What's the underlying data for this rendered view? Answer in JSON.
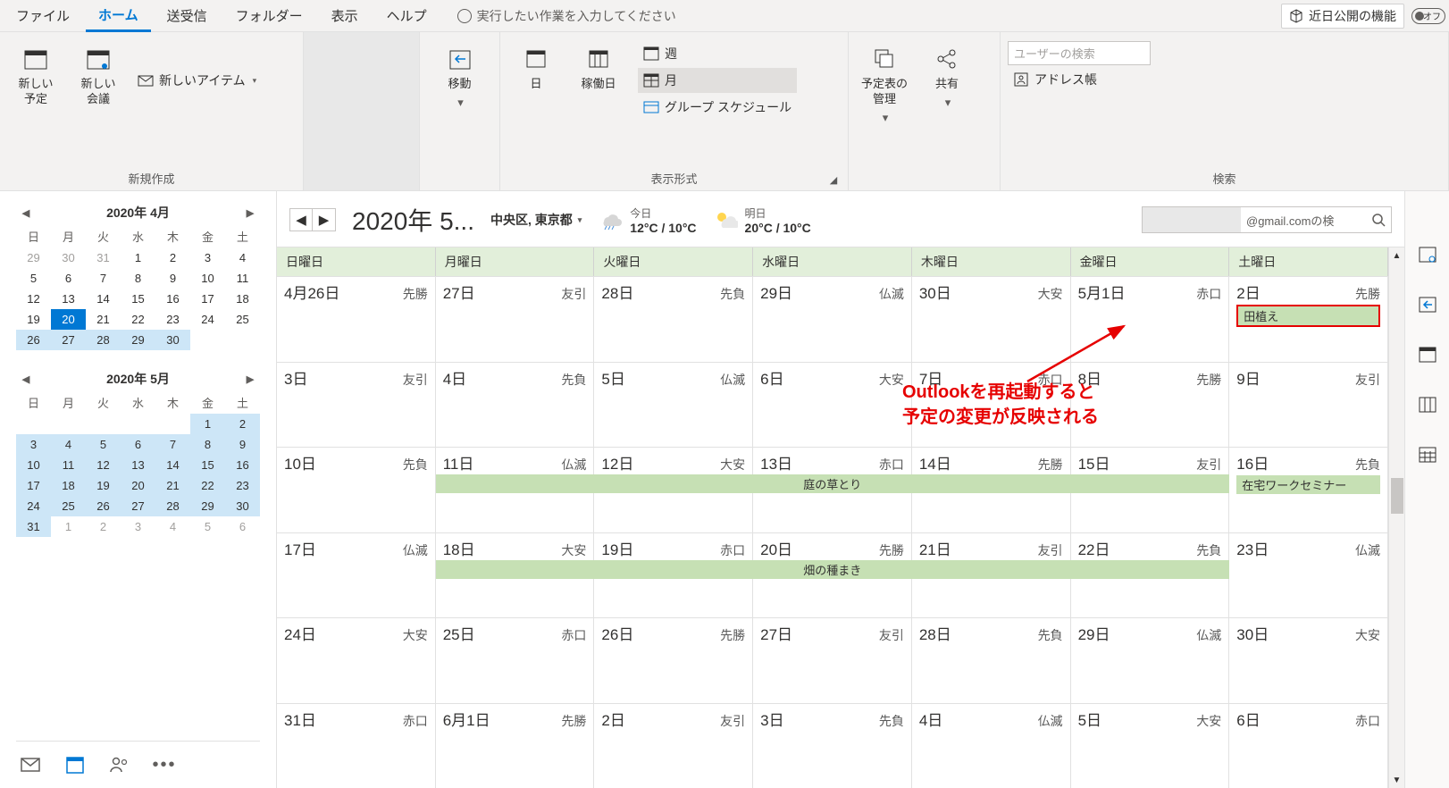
{
  "tabs": {
    "file": "ファイル",
    "home": "ホーム",
    "sendrecv": "送受信",
    "folder": "フォルダー",
    "view": "表示",
    "help": "ヘルプ",
    "tellme": "実行したい作業を入力してください",
    "coming": "近日公開の機能",
    "toggle_off": "オフ"
  },
  "ribbon": {
    "new": {
      "label": "新規作成",
      "appt": "新しい\n予定",
      "meeting": "新しい\n会議",
      "items": "新しいアイテム"
    },
    "goto": {
      "move": "移動"
    },
    "arrange": {
      "label": "表示形式",
      "day": "日",
      "workweek": "稼働日",
      "week": "週",
      "month": "月",
      "group": "グループ スケジュール"
    },
    "manage": {
      "schedule": "予定表の\n管理",
      "share": "共有"
    },
    "find": {
      "label": "検索",
      "search_user": "ユーザーの検索",
      "address": "アドレス帳"
    }
  },
  "mini": {
    "apr": {
      "title": "2020年 4月",
      "dow": [
        "日",
        "月",
        "火",
        "水",
        "木",
        "金",
        "土"
      ],
      "cells": [
        {
          "n": "29",
          "o": 1
        },
        {
          "n": "30",
          "o": 1
        },
        {
          "n": "31",
          "o": 1
        },
        {
          "n": "1"
        },
        {
          "n": "2"
        },
        {
          "n": "3"
        },
        {
          "n": "4"
        },
        {
          "n": "5"
        },
        {
          "n": "6"
        },
        {
          "n": "7"
        },
        {
          "n": "8"
        },
        {
          "n": "9"
        },
        {
          "n": "10"
        },
        {
          "n": "11"
        },
        {
          "n": "12"
        },
        {
          "n": "13"
        },
        {
          "n": "14"
        },
        {
          "n": "15"
        },
        {
          "n": "16"
        },
        {
          "n": "17"
        },
        {
          "n": "18"
        },
        {
          "n": "19"
        },
        {
          "n": "20",
          "t": 1
        },
        {
          "n": "21"
        },
        {
          "n": "22"
        },
        {
          "n": "23"
        },
        {
          "n": "24"
        },
        {
          "n": "25"
        },
        {
          "n": "26",
          "s": 1
        },
        {
          "n": "27",
          "s": 1
        },
        {
          "n": "28",
          "s": 1
        },
        {
          "n": "29",
          "s": 1
        },
        {
          "n": "30",
          "s": 1
        },
        {
          "n": ""
        },
        {
          "n": ""
        }
      ]
    },
    "may": {
      "title": "2020年 5月",
      "dow": [
        "日",
        "月",
        "火",
        "水",
        "木",
        "金",
        "土"
      ],
      "cells": [
        {
          "n": ""
        },
        {
          "n": ""
        },
        {
          "n": ""
        },
        {
          "n": ""
        },
        {
          "n": ""
        },
        {
          "n": "1",
          "s": 1
        },
        {
          "n": "2",
          "s": 1
        },
        {
          "n": "3",
          "s": 1
        },
        {
          "n": "4",
          "s": 1
        },
        {
          "n": "5",
          "s": 1
        },
        {
          "n": "6",
          "s": 1
        },
        {
          "n": "7",
          "s": 1
        },
        {
          "n": "8",
          "s": 1
        },
        {
          "n": "9",
          "s": 1
        },
        {
          "n": "10",
          "s": 1
        },
        {
          "n": "11",
          "s": 1
        },
        {
          "n": "12",
          "s": 1
        },
        {
          "n": "13",
          "s": 1
        },
        {
          "n": "14",
          "s": 1
        },
        {
          "n": "15",
          "s": 1
        },
        {
          "n": "16",
          "s": 1
        },
        {
          "n": "17",
          "s": 1
        },
        {
          "n": "18",
          "s": 1
        },
        {
          "n": "19",
          "s": 1
        },
        {
          "n": "20",
          "s": 1
        },
        {
          "n": "21",
          "s": 1
        },
        {
          "n": "22",
          "s": 1
        },
        {
          "n": "23",
          "s": 1
        },
        {
          "n": "24",
          "s": 1
        },
        {
          "n": "25",
          "s": 1
        },
        {
          "n": "26",
          "s": 1
        },
        {
          "n": "27",
          "s": 1
        },
        {
          "n": "28",
          "s": 1
        },
        {
          "n": "29",
          "s": 1
        },
        {
          "n": "30",
          "s": 1
        },
        {
          "n": "31",
          "s": 1
        },
        {
          "n": "1",
          "o": 1
        },
        {
          "n": "2",
          "o": 1
        },
        {
          "n": "3",
          "o": 1
        },
        {
          "n": "4",
          "o": 1
        },
        {
          "n": "5",
          "o": 1
        },
        {
          "n": "6",
          "o": 1
        }
      ]
    }
  },
  "header": {
    "title": "2020年 5...",
    "location": "中央区, 東京都",
    "today": {
      "label": "今日",
      "temp": "12°C / 10°C"
    },
    "tomorrow": {
      "label": "明日",
      "temp": "20°C / 10°C"
    },
    "search_placeholder": "@gmail.comの検"
  },
  "dow": [
    "日曜日",
    "月曜日",
    "火曜日",
    "水曜日",
    "木曜日",
    "金曜日",
    "土曜日"
  ],
  "weeks": [
    [
      {
        "d": "4月26日",
        "r": "先勝"
      },
      {
        "d": "27日",
        "r": "友引"
      },
      {
        "d": "28日",
        "r": "先負"
      },
      {
        "d": "29日",
        "r": "仏滅"
      },
      {
        "d": "30日",
        "r": "大安"
      },
      {
        "d": "5月1日",
        "r": "赤口"
      },
      {
        "d": "2日",
        "r": "先勝",
        "ev": "田植え",
        "hl": 1
      }
    ],
    [
      {
        "d": "3日",
        "r": "友引"
      },
      {
        "d": "4日",
        "r": "先負"
      },
      {
        "d": "5日",
        "r": "仏滅"
      },
      {
        "d": "6日",
        "r": "大安"
      },
      {
        "d": "7日",
        "r": "赤口"
      },
      {
        "d": "8日",
        "r": "先勝"
      },
      {
        "d": "9日",
        "r": "友引"
      }
    ],
    [
      {
        "d": "10日",
        "r": "先負"
      },
      {
        "d": "11日",
        "r": "仏滅"
      },
      {
        "d": "12日",
        "r": "大安"
      },
      {
        "d": "13日",
        "r": "赤口"
      },
      {
        "d": "14日",
        "r": "先勝"
      },
      {
        "d": "15日",
        "r": "友引"
      },
      {
        "d": "16日",
        "r": "先負",
        "ev": "在宅ワークセミナー"
      }
    ],
    [
      {
        "d": "17日",
        "r": "仏滅"
      },
      {
        "d": "18日",
        "r": "大安"
      },
      {
        "d": "19日",
        "r": "赤口"
      },
      {
        "d": "20日",
        "r": "先勝"
      },
      {
        "d": "21日",
        "r": "友引"
      },
      {
        "d": "22日",
        "r": "先負"
      },
      {
        "d": "23日",
        "r": "仏滅"
      }
    ],
    [
      {
        "d": "24日",
        "r": "大安"
      },
      {
        "d": "25日",
        "r": "赤口"
      },
      {
        "d": "26日",
        "r": "先勝"
      },
      {
        "d": "27日",
        "r": "友引"
      },
      {
        "d": "28日",
        "r": "先負"
      },
      {
        "d": "29日",
        "r": "仏滅"
      },
      {
        "d": "30日",
        "r": "大安"
      }
    ],
    [
      {
        "d": "31日",
        "r": "赤口"
      },
      {
        "d": "6月1日",
        "r": "先勝"
      },
      {
        "d": "2日",
        "r": "友引"
      },
      {
        "d": "3日",
        "r": "先負"
      },
      {
        "d": "4日",
        "r": "仏滅"
      },
      {
        "d": "5日",
        "r": "大安"
      },
      {
        "d": "6日",
        "r": "赤口"
      }
    ]
  ],
  "span_events": {
    "week3": "庭の草とり",
    "week4": "畑の種まき"
  },
  "annotation": "Outlookを再起動すると\n予定の変更が反映される"
}
